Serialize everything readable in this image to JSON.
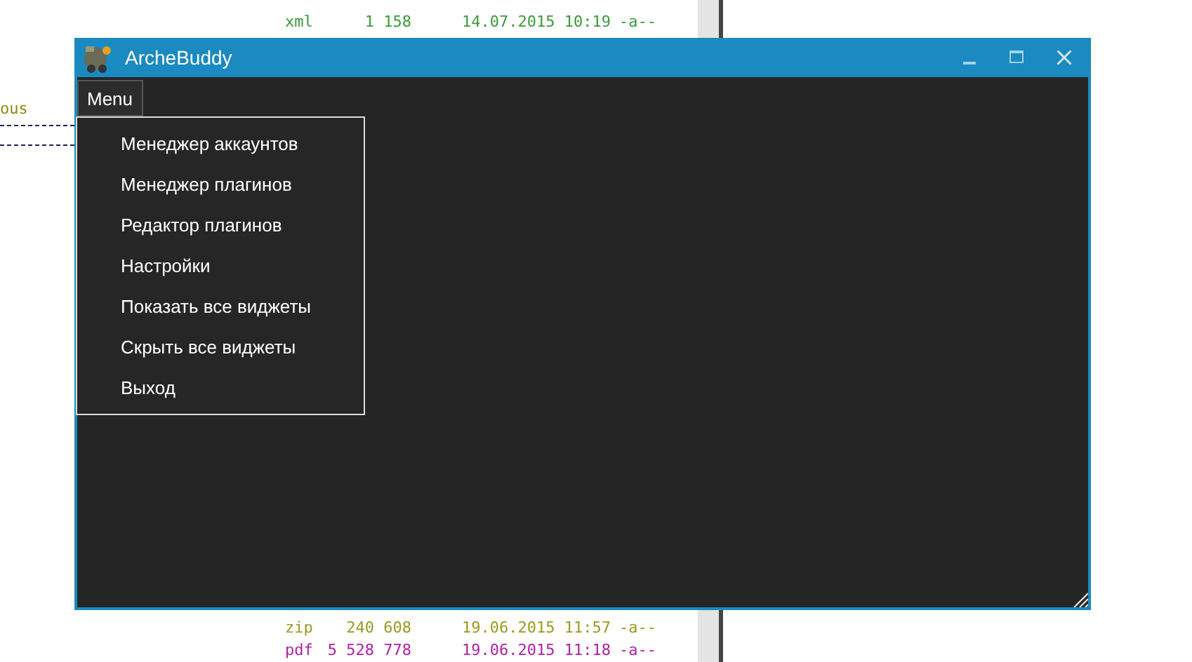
{
  "background_listing": {
    "fragment": "ous",
    "rows": [
      {
        "ext": "xml",
        "size": "1 158",
        "date": "14.07.2015 10:19",
        "attrs": "-a--",
        "color": "#3a9a3a"
      },
      {
        "ext": "zip",
        "size": "240 608",
        "date": "19.06.2015 11:57",
        "attrs": "-a--",
        "color": "#9a9a20"
      },
      {
        "ext": "pdf",
        "size": "5 528 778",
        "date": "19.06.2015 11:18",
        "attrs": "-a--",
        "color": "#b020a0"
      }
    ]
  },
  "window": {
    "title": "ArcheBuddy",
    "menu_button": "Menu",
    "menu_open": true,
    "menu_items": [
      "Менеджер аккаунтов",
      "Менеджер плагинов",
      "Редактор плагинов",
      "Настройки",
      "Показать все виджеты",
      "Скрыть все виджеты",
      "Выход"
    ]
  }
}
